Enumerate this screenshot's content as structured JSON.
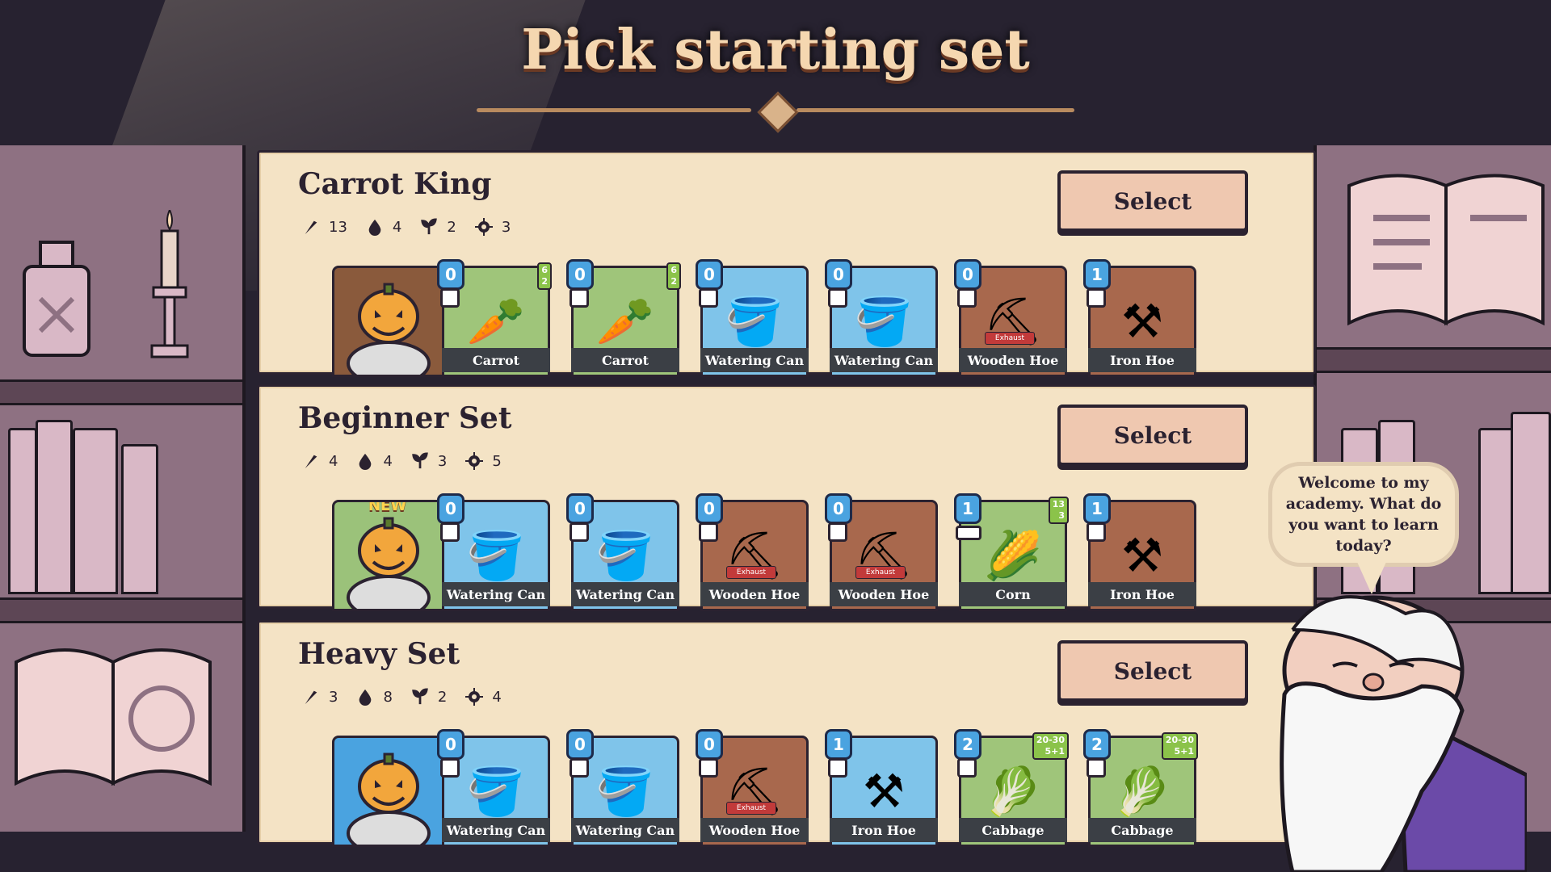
{
  "title": "Pick starting set",
  "speech": "Welcome to my academy. What do you want to learn today?",
  "select_label": "Select",
  "sets": [
    {
      "name": "Carrot King",
      "stats": {
        "hoe": "13",
        "water": "4",
        "sprout": "2",
        "gear": "3"
      },
      "hero": {
        "icon": "pumpkin-scarecrow",
        "new": ""
      },
      "cards": [
        {
          "name": "Carrot",
          "cost": "0",
          "type": "green",
          "icon": "carrot-icon",
          "yield_top": "6",
          "yield_bottom": "2",
          "exhaust": ""
        },
        {
          "name": "Carrot",
          "cost": "0",
          "type": "green",
          "icon": "carrot-icon",
          "yield_top": "6",
          "yield_bottom": "2",
          "exhaust": ""
        },
        {
          "name": "Watering Can",
          "cost": "0",
          "type": "blue",
          "icon": "watering-can-icon",
          "yield_top": "",
          "yield_bottom": "",
          "exhaust": ""
        },
        {
          "name": "Watering Can",
          "cost": "0",
          "type": "blue",
          "icon": "watering-can-icon",
          "yield_top": "",
          "yield_bottom": "",
          "exhaust": ""
        },
        {
          "name": "Wooden Hoe",
          "cost": "0",
          "type": "brown",
          "icon": "wooden-hoe-icon",
          "yield_top": "",
          "yield_bottom": "",
          "exhaust": "Exhaust"
        },
        {
          "name": "Iron Hoe",
          "cost": "1",
          "type": "brown",
          "icon": "iron-hoe-icon",
          "yield_top": "",
          "yield_bottom": "",
          "exhaust": ""
        }
      ]
    },
    {
      "name": "Beginner Set",
      "stats": {
        "hoe": "4",
        "water": "4",
        "sprout": "3",
        "gear": "5"
      },
      "hero": {
        "icon": "pumpkin-mage",
        "new": "NEW"
      },
      "cards": [
        {
          "name": "Watering Can",
          "cost": "0",
          "type": "blue",
          "icon": "watering-can-icon",
          "yield_top": "",
          "yield_bottom": "",
          "exhaust": ""
        },
        {
          "name": "Watering Can",
          "cost": "0",
          "type": "blue",
          "icon": "watering-can-icon",
          "yield_top": "",
          "yield_bottom": "",
          "exhaust": ""
        },
        {
          "name": "Wooden Hoe",
          "cost": "0",
          "type": "brown",
          "icon": "wooden-hoe-icon",
          "yield_top": "",
          "yield_bottom": "",
          "exhaust": "Exhaust"
        },
        {
          "name": "Wooden Hoe",
          "cost": "0",
          "type": "brown",
          "icon": "wooden-hoe-icon",
          "yield_top": "",
          "yield_bottom": "",
          "exhaust": "Exhaust"
        },
        {
          "name": "Corn",
          "cost": "1",
          "type": "green",
          "icon": "corn-icon",
          "yield_top": "13",
          "yield_bottom": "3",
          "exhaust": ""
        },
        {
          "name": "Iron Hoe",
          "cost": "1",
          "type": "brown",
          "icon": "iron-hoe-icon",
          "yield_top": "",
          "yield_bottom": "",
          "exhaust": ""
        }
      ]
    },
    {
      "name": "Heavy Set",
      "stats": {
        "hoe": "3",
        "water": "8",
        "sprout": "2",
        "gear": "4"
      },
      "hero": {
        "icon": "pumpkin-merchant",
        "new": ""
      },
      "cards": [
        {
          "name": "Watering Can",
          "cost": "0",
          "type": "blue",
          "icon": "watering-can-icon",
          "yield_top": "",
          "yield_bottom": "",
          "exhaust": ""
        },
        {
          "name": "Watering Can",
          "cost": "0",
          "type": "blue",
          "icon": "watering-can-icon",
          "yield_top": "",
          "yield_bottom": "",
          "exhaust": ""
        },
        {
          "name": "Wooden Hoe",
          "cost": "0",
          "type": "brown",
          "icon": "wooden-hoe-icon",
          "yield_top": "",
          "yield_bottom": "",
          "exhaust": "Exhaust"
        },
        {
          "name": "Iron Hoe",
          "cost": "1",
          "type": "blue",
          "icon": "iron-hoe-icon",
          "yield_top": "",
          "yield_bottom": "",
          "exhaust": ""
        },
        {
          "name": "Cabbage",
          "cost": "2",
          "type": "green",
          "icon": "cabbage-icon",
          "yield_top": "20-30",
          "yield_bottom": "5+1",
          "exhaust": ""
        },
        {
          "name": "Cabbage",
          "cost": "2",
          "type": "green",
          "icon": "cabbage-icon",
          "yield_top": "20-30",
          "yield_bottom": "5+1",
          "exhaust": ""
        }
      ]
    }
  ]
}
